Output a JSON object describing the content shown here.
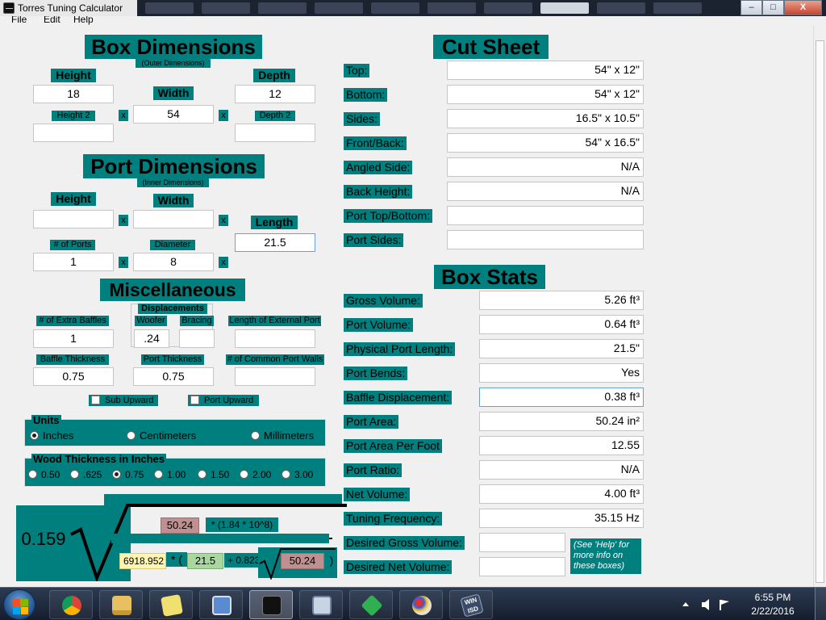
{
  "window": {
    "title": "Torres Tuning Calculator",
    "minimize": "–",
    "maximize": "□",
    "close": "X"
  },
  "menu": [
    "File",
    "Edit",
    "Help"
  ],
  "box": {
    "heading": "Box Dimensions",
    "subheading": "(Outer Dimensions)",
    "height_label": "Height",
    "height_value": "18",
    "width_label": "Width",
    "width_value": "54",
    "depth_label": "Depth",
    "depth_value": "12",
    "height2_label": "Height 2",
    "height2_value": "",
    "depth2_label": "Depth 2",
    "depth2_value": "",
    "x": "x"
  },
  "port": {
    "heading": "Port Dimensions",
    "subheading": "(Inner Dimensions)",
    "height_label": "Height",
    "height_value": "",
    "width_label": "Width",
    "width_value": "",
    "length_label": "Length",
    "length_value": "21.5",
    "num_ports_label": "# of Ports",
    "num_ports_value": "1",
    "diameter_label": "Diameter",
    "diameter_value": "8",
    "x": "x"
  },
  "misc": {
    "heading": "Miscellaneous",
    "extra_baffles_label": "# of Extra Baffles",
    "extra_baffles_value": "1",
    "displacements_label": "Displacements",
    "woofer_label": "Woofer",
    "woofer_value": ".24",
    "bracing_label": "Bracing",
    "bracing_value": "",
    "ext_port_label": "Length of External Port",
    "ext_port_value": "",
    "baffle_thickness_label": "Baffle Thickness",
    "baffle_thickness_value": "0.75",
    "port_thickness_label": "Port Thickness",
    "port_thickness_value": "0.75",
    "common_walls_label": "# of Common Port Walls",
    "common_walls_value": "",
    "sub_upward": "Sub Upward",
    "port_upward": "Port Upward"
  },
  "units": {
    "label": "Units",
    "options": [
      "Inches",
      "Centimeters",
      "Millimeters"
    ],
    "selected": "Inches"
  },
  "wood": {
    "label": "Wood Thickness in Inches",
    "options": [
      "0.50",
      ".625",
      "0.75",
      "1.00",
      "1.50",
      "2.00",
      "3.00"
    ],
    "selected": "0.75"
  },
  "formula": {
    "constant": "0.159",
    "area": "50.24",
    "multiplier": "* (1.84 * 10^8)",
    "volume": "6918.952",
    "times": "* (",
    "length": "21.5",
    "plus": "+ 0.823",
    "area2": "50.24",
    "close": ")"
  },
  "cut_sheet": {
    "heading": "Cut Sheet",
    "rows": [
      {
        "label": "Top:",
        "value": "54\" x 12\""
      },
      {
        "label": "Bottom:",
        "value": "54\" x 12\""
      },
      {
        "label": "Sides:",
        "value": "16.5\" x 10.5\""
      },
      {
        "label": "Front/Back:",
        "value": "54\" x 16.5\""
      },
      {
        "label": "Angled Side:",
        "value": "N/A"
      },
      {
        "label": "Back Height:",
        "value": "N/A"
      },
      {
        "label": "Port Top/Bottom:",
        "value": ""
      },
      {
        "label": "Port Sides:",
        "value": ""
      }
    ]
  },
  "box_stats": {
    "heading": "Box Stats",
    "rows": [
      {
        "label": "Gross Volume:",
        "value": "5.26 ft³"
      },
      {
        "label": "Port Volume:",
        "value": "0.64 ft³"
      },
      {
        "label": "Physical Port Length:",
        "value": "21.5\""
      },
      {
        "label": "Port Bends:",
        "value": "Yes"
      },
      {
        "label": "Baffle Displacement:",
        "value": "0.38 ft³"
      },
      {
        "label": "Port Area:",
        "value": "50.24 in²"
      },
      {
        "label": "Port Area Per Foot",
        "value": "12.55"
      },
      {
        "label": "Port Ratio:",
        "value": "N/A"
      },
      {
        "label": "Net Volume:",
        "value": "4.00 ft³"
      },
      {
        "label": "Tuning Frequency:",
        "value": "35.15 Hz"
      }
    ],
    "desired_gross_label": "Desired Gross Volume:",
    "desired_gross_value": "",
    "desired_net_label": "Desired Net Volume:",
    "desired_net_value": "",
    "hint": "(See 'Help' for more info on these boxes)"
  },
  "taskbar": {
    "time": "6:55 PM",
    "date": "2/22/2016",
    "apps": [
      "chrome-icon",
      "explorer-icon",
      "notes-icon",
      "control-panel-icon",
      "audio-app-icon",
      "calculator-icon",
      "gem-icon",
      "paint-icon",
      "winisd-icon"
    ],
    "app_badge": "WIN ISD"
  },
  "colors": {
    "teal": "#007f7f",
    "pink": "#c09090",
    "green": "#a8d8a0",
    "yellow": "#fff5b0"
  }
}
